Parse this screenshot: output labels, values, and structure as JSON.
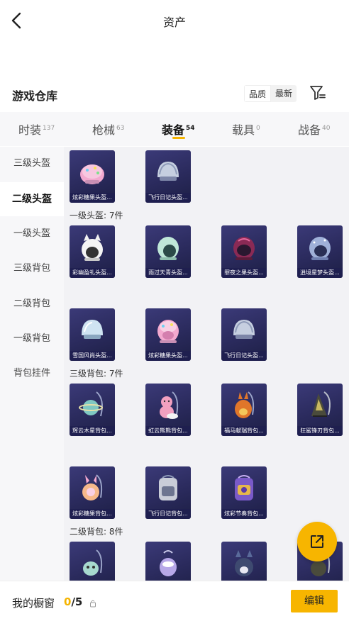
{
  "header": {
    "title": "资产"
  },
  "warehouse": {
    "title": "游戏仓库",
    "sort_quality": "品质",
    "sort_latest": "最新"
  },
  "tabs": [
    {
      "label": "时装",
      "count": "137"
    },
    {
      "label": "枪械",
      "count": "63"
    },
    {
      "label": "装备",
      "count": "54"
    },
    {
      "label": "载具",
      "count": "0"
    },
    {
      "label": "战备",
      "count": "40"
    }
  ],
  "sidebar": [
    "三级头盔",
    "二级头盔",
    "一级头盔",
    "三级背包",
    "二级背包",
    "一级背包",
    "背包挂件"
  ],
  "sections": {
    "helmet1": "一级头盔: 7件",
    "bag3": "三级背包: 7件",
    "bag2": "二级背包: 8件"
  },
  "items": {
    "r1": [
      "炫彩糖果头盔...",
      "飞行日记头盔..."
    ],
    "r2": [
      "彩幽盈礼头盔...",
      "雨过天青头盔...",
      "罪夜之果头盔...",
      "逍境星梦头盔..."
    ],
    "r3": [
      "雪国风尚头盔...",
      "炫彩糖果头盔...",
      "飞行日记头盔..."
    ],
    "r4": [
      "辉云木星背包...",
      "虹云熊熊背包...",
      "福马献瑞背包...",
      "狂鲨锋刃背包..."
    ],
    "r5": [
      "炫彩糖果背包...",
      "飞行日记背包...",
      "炫彩节奏背包..."
    ]
  },
  "bottom": {
    "showcase_label": "我的橱窗",
    "count_current": "0",
    "count_total": "/5",
    "edit_label": "编辑"
  },
  "colors": {
    "accent": "#f7b500",
    "card_bg": "#2c2b62"
  }
}
